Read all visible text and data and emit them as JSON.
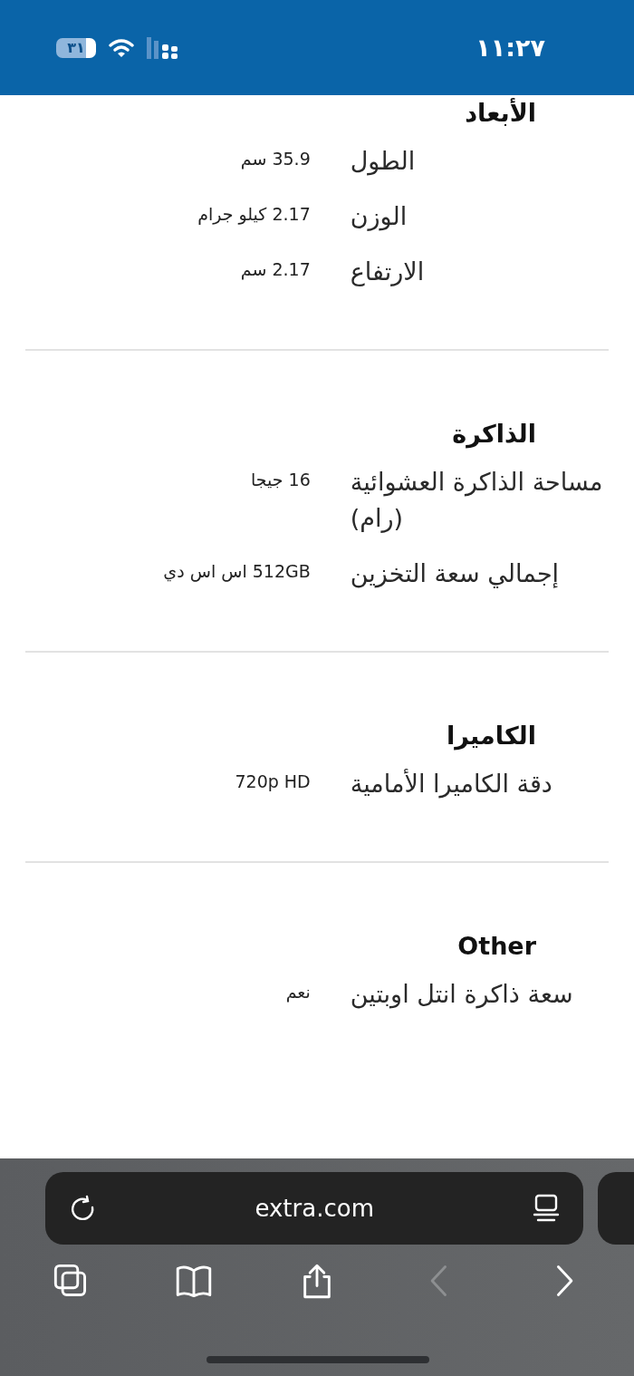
{
  "status_bar": {
    "time": "١١:٢٧",
    "battery": "٣١"
  },
  "sections": [
    {
      "title": "الأبعاد",
      "rows": [
        {
          "label": "الطول",
          "value": "35.9 سم"
        },
        {
          "label": "الوزن",
          "value": "2.17 كيلو جرام"
        },
        {
          "label": "الارتفاع",
          "value": "2.17 سم"
        }
      ]
    },
    {
      "title": "الذاكرة",
      "rows": [
        {
          "label": "مساحة الذاكرة العشوائية (رام)",
          "value": "16 جيجا"
        },
        {
          "label": "إجمالي سعة التخزين",
          "value": "512GB اس اس دي"
        }
      ]
    },
    {
      "title": "الكاميرا",
      "rows": [
        {
          "label": "دقة الكاميرا الأمامية",
          "value": "720p HD"
        }
      ]
    },
    {
      "title": "Other",
      "rows": [
        {
          "label": "سعة ذاكرة انتل اوبتين",
          "value": "نعم"
        }
      ]
    }
  ],
  "browser": {
    "url": "extra.com"
  },
  "toolbar": [
    {
      "kind": "tabs",
      "disabled": false
    },
    {
      "kind": "bookmarks",
      "disabled": false
    },
    {
      "kind": "share",
      "disabled": false
    },
    {
      "kind": "back",
      "disabled": true
    },
    {
      "kind": "forward",
      "disabled": false
    }
  ]
}
